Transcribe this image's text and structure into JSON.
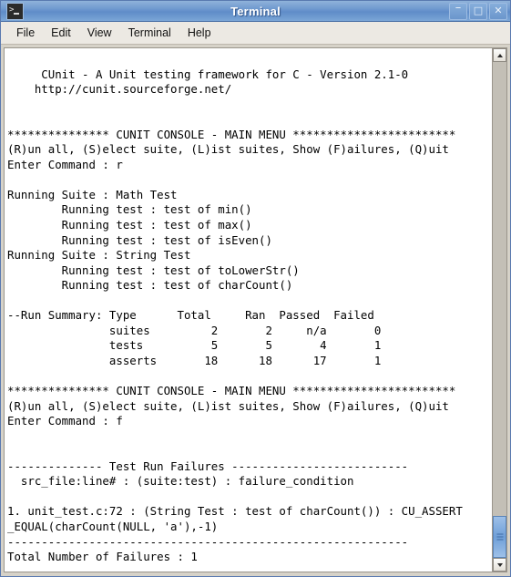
{
  "window": {
    "title": "Terminal",
    "icon": "terminal-icon",
    "controls": {
      "minimize": "–",
      "maximize": "□",
      "close": "✕"
    }
  },
  "menubar": {
    "items": [
      {
        "label": "File"
      },
      {
        "label": "Edit"
      },
      {
        "label": "View"
      },
      {
        "label": "Terminal"
      },
      {
        "label": "Help"
      }
    ]
  },
  "terminal": {
    "content": "\n     CUnit - A Unit testing framework for C - Version 2.1-0\n    http://cunit.sourceforge.net/\n\n\n*************** CUNIT CONSOLE - MAIN MENU ************************\n(R)un all, (S)elect suite, (L)ist suites, Show (F)ailures, (Q)uit\nEnter Command : r\n\nRunning Suite : Math Test\n        Running test : test of min()\n        Running test : test of max()\n        Running test : test of isEven()\nRunning Suite : String Test\n        Running test : test of toLowerStr()\n        Running test : test of charCount()\n\n--Run Summary: Type      Total     Ran  Passed  Failed\n               suites         2       2     n/a       0\n               tests          5       5       4       1\n               asserts       18      18      17       1\n\n*************** CUNIT CONSOLE - MAIN MENU ************************\n(R)un all, (S)elect suite, (L)ist suites, Show (F)ailures, (Q)uit\nEnter Command : f\n\n\n-------------- Test Run Failures --------------------------\n  src_file:line# : (suite:test) : failure_condition\n\n1. unit_test.c:72 : (String Test : test of charCount()) : CU_ASSERT\n_EQUAL(charCount(NULL, 'a'),-1)\n-----------------------------------------------------------\nTotal Number of Failures : 1\n",
    "program": {
      "name": "CUnit",
      "description": "A Unit testing framework for C",
      "version": "Version 2.1-0",
      "url": "http://cunit.sourceforge.net/"
    },
    "menu": {
      "header": "CUNIT CONSOLE - MAIN MENU",
      "options": "(R)un all, (S)elect suite, (L)ist suites, Show (F)ailures, (Q)uit",
      "prompt": "Enter Command : ",
      "commands_entered": [
        "r",
        "f"
      ]
    },
    "suites_run": [
      {
        "suite": "Math Test",
        "tests": [
          "test of min()",
          "test of max()",
          "test of isEven()"
        ]
      },
      {
        "suite": "String Test",
        "tests": [
          "test of toLowerStr()",
          "test of charCount()"
        ]
      }
    ],
    "run_summary": {
      "label": "--Run Summary:",
      "columns": [
        "Type",
        "Total",
        "Ran",
        "Passed",
        "Failed"
      ],
      "rows": [
        {
          "type": "suites",
          "total": "2",
          "ran": "2",
          "passed": "n/a",
          "failed": "0"
        },
        {
          "type": "tests",
          "total": "5",
          "ran": "5",
          "passed": "4",
          "failed": "1"
        },
        {
          "type": "asserts",
          "total": "18",
          "ran": "18",
          "passed": "17",
          "failed": "1"
        }
      ]
    },
    "failures": {
      "header": "Test Run Failures",
      "legend": "src_file:line# : (suite:test) : failure_condition",
      "entries": [
        {
          "index": "1.",
          "location": "unit_test.c:72",
          "context": "(String Test : test of charCount())",
          "condition": "CU_ASSERT_EQUAL(charCount(NULL, 'a'),-1)"
        }
      ],
      "total_line": "Total Number of Failures : 1"
    }
  },
  "scrollbar": {
    "up_arrow": "scroll-up-arrow-icon",
    "down_arrow": "scroll-down-arrow-icon",
    "position": "bottom"
  },
  "colors": {
    "titlebar_accent": "#6f99cf",
    "terminal_bg": "#ffffff",
    "terminal_fg": "#000000",
    "chrome_bg": "#d6d2c8",
    "scroll_thumb": "#6f9fd8"
  }
}
